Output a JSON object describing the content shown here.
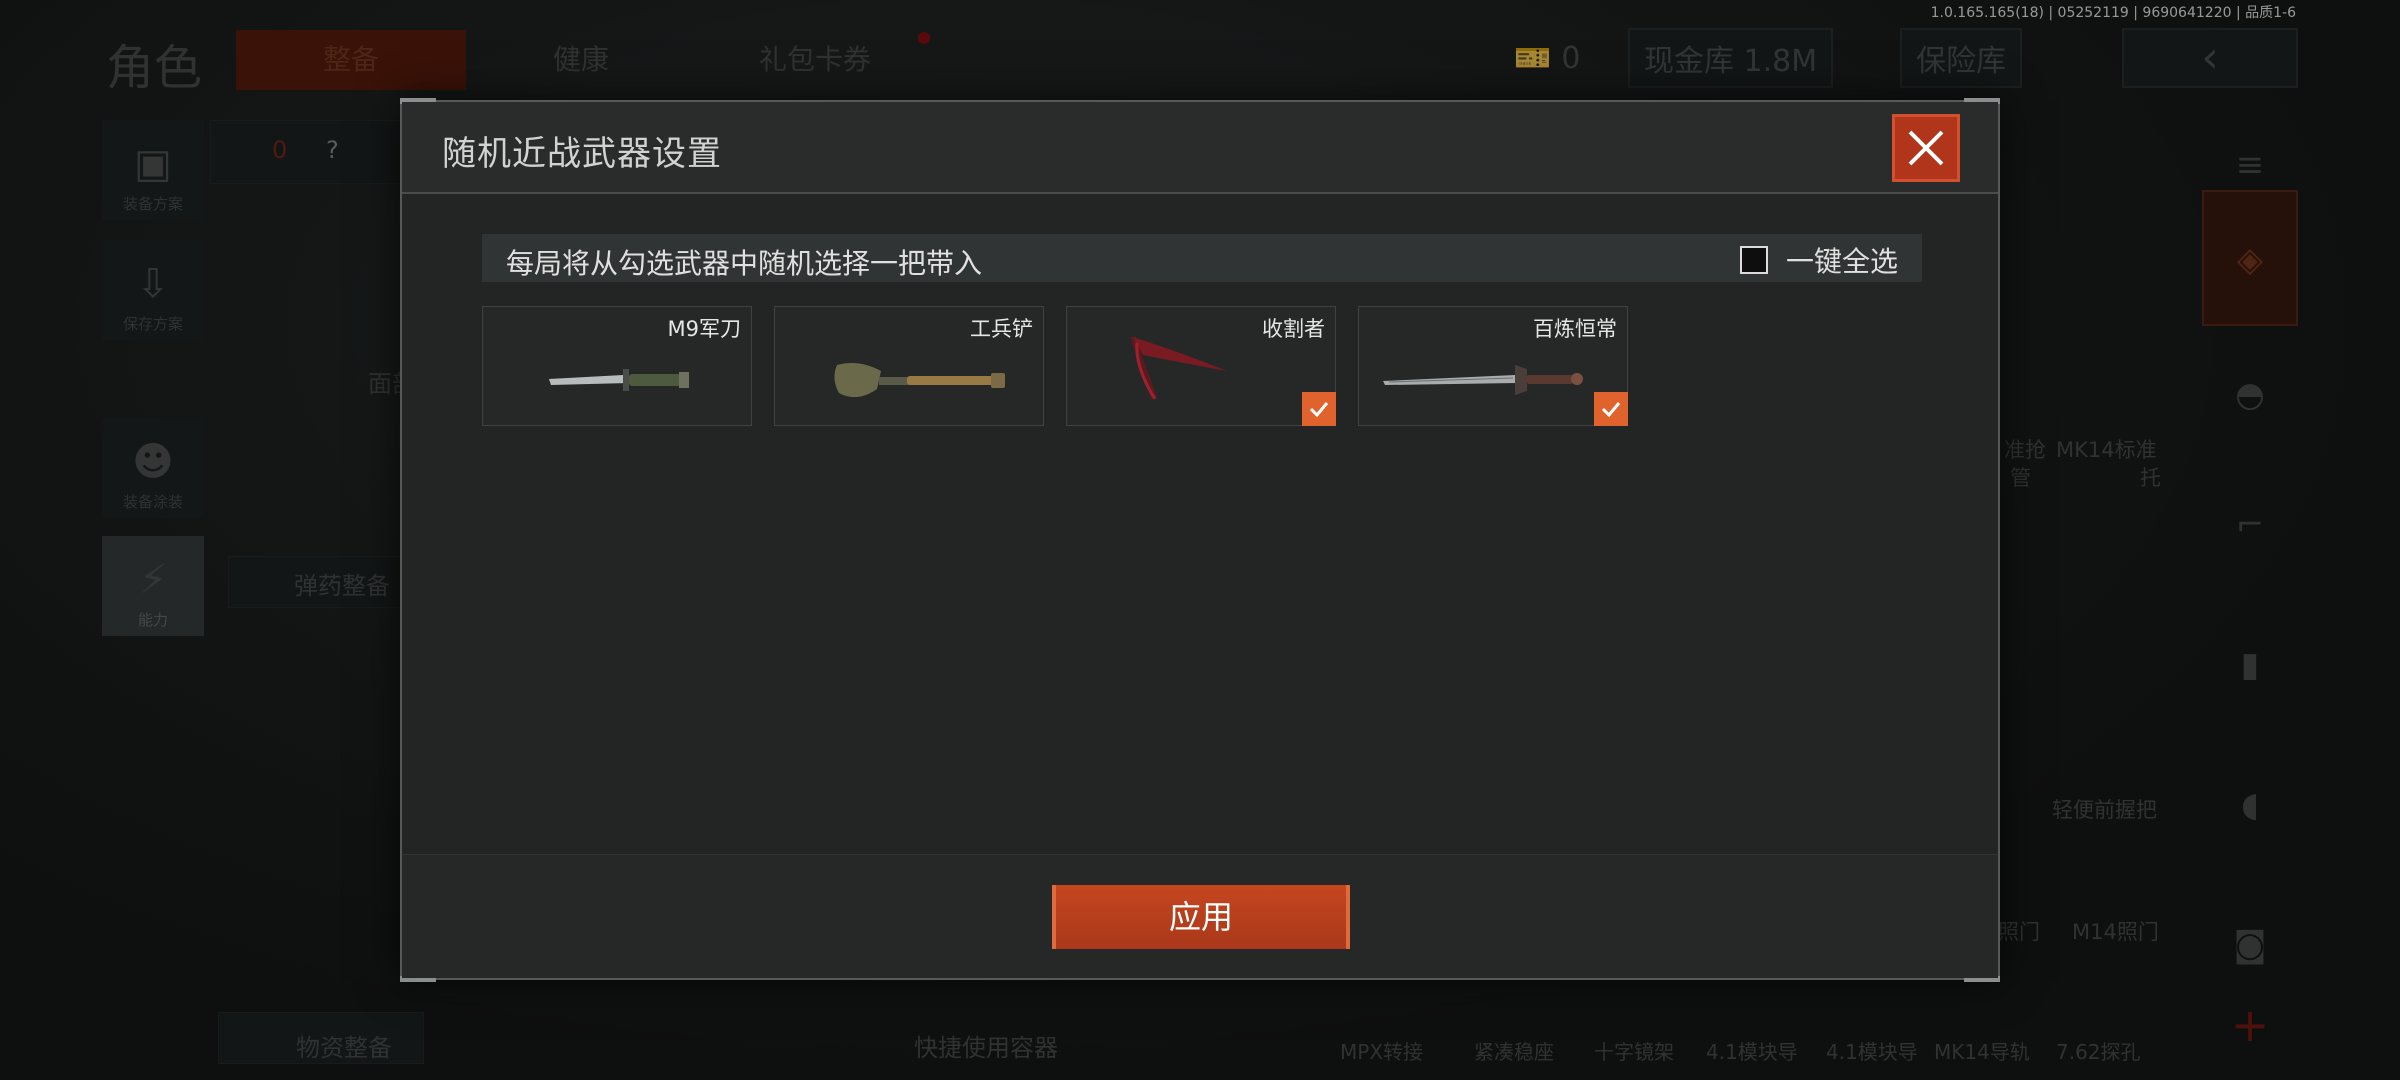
{
  "version_info": "1.0.165.165(18) | 05252119 | 9690641220 | 品质1-6",
  "background": {
    "title": "角色",
    "tabs": [
      {
        "label": "整备"
      },
      {
        "label": "健康"
      },
      {
        "label": "礼包卡券"
      }
    ],
    "currency": {
      "tickets": "0",
      "cash_vault": "现金库 1.8M",
      "safe_vault": "保险库"
    },
    "left_buttons": [
      {
        "label": "装备方案"
      },
      {
        "label": "保存方案"
      },
      {
        "label": "装备涂装"
      },
      {
        "label": "能力"
      }
    ],
    "armor_count": "0",
    "help": "?",
    "labels": {
      "face": "面部",
      "ammo": "弹药整备",
      "supplies": "物资整备",
      "quick_container": "快捷使用容器",
      "sniper": "准抢",
      "tube": "管",
      "mk14_std": "MK14标准",
      "stock": "托",
      "grip": "轻便前握把",
      "m14_sight": "M14照门",
      "sight2": "照门",
      "bottom_items": [
        "MPX转接",
        "紧凑稳座",
        "十字镜架",
        "4.1模块导",
        "4.1模块导",
        "MK14导轨",
        "7.62探孔"
      ]
    }
  },
  "modal": {
    "title": "随机近战武器设置",
    "hint": "每局将从勾选武器中随机选择一把带入",
    "select_all_label": "一键全选",
    "select_all_checked": false,
    "weapons": [
      {
        "name": "M9军刀",
        "checked": false
      },
      {
        "name": "工兵铲",
        "checked": false
      },
      {
        "name": "收割者",
        "checked": true
      },
      {
        "name": "百炼恒常",
        "checked": true
      }
    ],
    "apply_label": "应用"
  },
  "colors": {
    "accent": "#c5461f",
    "check": "#e0622c"
  }
}
